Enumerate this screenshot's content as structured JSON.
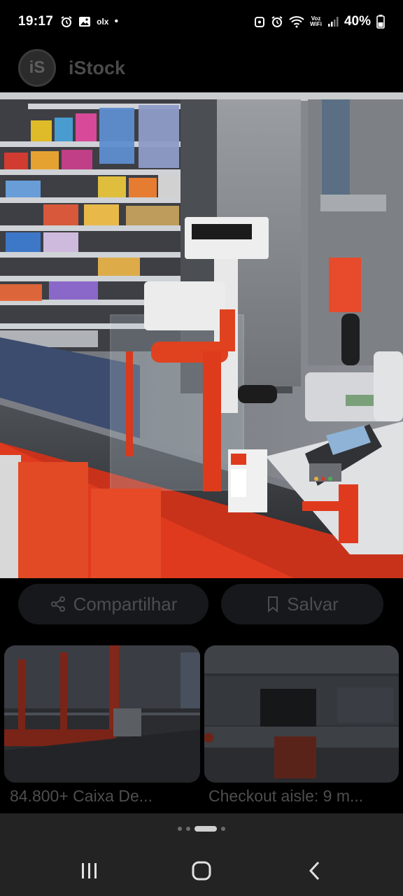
{
  "status_bar": {
    "time": "19:17",
    "left_icons": [
      "alarm-icon",
      "gallery-icon",
      "olx-icon",
      "notification-dot"
    ],
    "olx_label": "olx",
    "dot": "•",
    "right_icons": [
      "alarm-badge-icon",
      "alarm-icon",
      "wifi-icon",
      "signal-icon",
      "battery-icon"
    ],
    "voz_line1": "Voz",
    "voz_line2": "WiFi",
    "battery": "40%"
  },
  "app": {
    "logo_text": "iS",
    "name": "iStock"
  },
  "hero": {
    "icon": "image-icon"
  },
  "actions": {
    "share_label": "Compartilhar",
    "share_icon": "share-icon",
    "save_label": "Salvar",
    "save_icon": "bookmark-icon"
  },
  "related": [
    {
      "caption": "84.800+ Caixa De..."
    },
    {
      "caption": "Checkout aisle: 9 m..."
    }
  ],
  "pager": {
    "count": 4,
    "active": 2
  },
  "navbar": {
    "recents_icon": "recents-icon",
    "home_icon": "home-icon",
    "back_icon": "back-icon"
  },
  "colors": {
    "background": "#000000",
    "button_bg": "#17181b",
    "muted_text": "#4e4e4e",
    "navbar_bg": "#232323",
    "accent_red": "#e03a1e"
  }
}
